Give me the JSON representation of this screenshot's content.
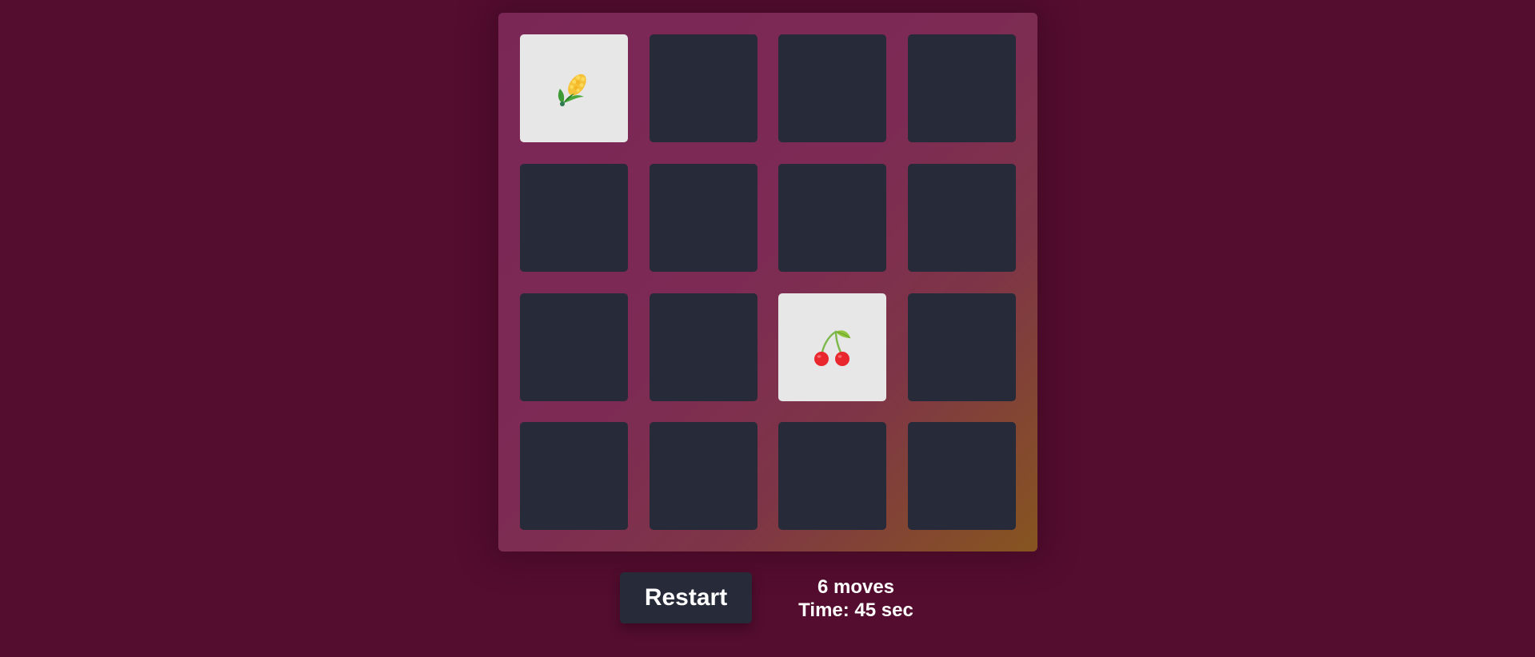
{
  "board": {
    "cards": [
      {
        "state": "revealed",
        "icon": "corn-icon"
      },
      {
        "state": "hidden",
        "icon": ""
      },
      {
        "state": "hidden",
        "icon": ""
      },
      {
        "state": "hidden",
        "icon": ""
      },
      {
        "state": "hidden",
        "icon": ""
      },
      {
        "state": "hidden",
        "icon": ""
      },
      {
        "state": "hidden",
        "icon": ""
      },
      {
        "state": "hidden",
        "icon": ""
      },
      {
        "state": "hidden",
        "icon": ""
      },
      {
        "state": "hidden",
        "icon": ""
      },
      {
        "state": "revealed",
        "icon": "cherries-icon"
      },
      {
        "state": "hidden",
        "icon": ""
      },
      {
        "state": "hidden",
        "icon": ""
      },
      {
        "state": "hidden",
        "icon": ""
      },
      {
        "state": "hidden",
        "icon": ""
      },
      {
        "state": "hidden",
        "icon": ""
      }
    ]
  },
  "controls": {
    "restart_label": "Restart",
    "moves_text": "6 moves",
    "time_text": "Time: 45 sec"
  },
  "colors": {
    "background": "#540d2f",
    "card_back": "#272a38",
    "card_face": "#e7e7e7",
    "board_gradient_start": "#7a2756",
    "board_gradient_end": "#87551f"
  }
}
